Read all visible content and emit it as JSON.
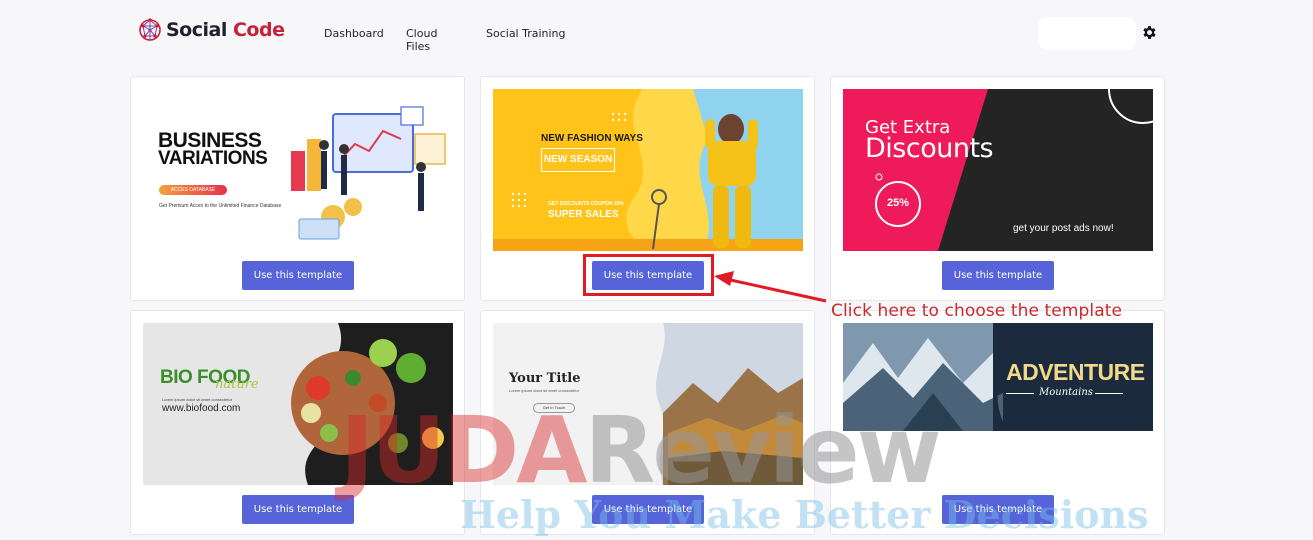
{
  "app": {
    "logo_part1": "Social",
    "logo_part2": "Code",
    "logo_icon": "network-globe-icon"
  },
  "nav": {
    "items": [
      "Dashboard",
      "Cloud Files",
      "Social Training"
    ]
  },
  "settings_icon": "gear-icon",
  "templates": [
    {
      "button_label": "Use this template",
      "preview": {
        "headline1": "BUSINESS",
        "headline2": "VARIATIONS",
        "pill": "ACCES DATABASE",
        "caption": "Get Premium Acces to the Unlimited Finance Database"
      }
    },
    {
      "button_label": "Use this template",
      "preview": {
        "headline": "NEW FASHION WAYS",
        "badge": "NEW SEASON",
        "line": "GET DISCOUNTS COUPON 20%",
        "sale": "SUPER SALES"
      }
    },
    {
      "button_label": "Use this template",
      "preview": {
        "headline1": "Get Extra",
        "headline2": "Discounts",
        "percent": "25%",
        "cta": "get your post ads now!"
      }
    },
    {
      "button_label": "Use this template",
      "preview": {
        "headline1": "BIO FOOD",
        "script": "nature",
        "caption": "Lorem ipsum dolor sit amet consectetur",
        "url": "www.biofood.com"
      }
    },
    {
      "button_label": "Use this template",
      "preview": {
        "headline": "Your Title",
        "caption": "Lorem ipsum dolor sit amet consectetur",
        "cta": "Get In Touch"
      }
    },
    {
      "button_label": "Use this template",
      "preview": {
        "headline": "ADVENTURE",
        "script": "Mountains"
      }
    }
  ],
  "annotation": {
    "text": "Click here to choose the template"
  },
  "watermark": {
    "main_red": "JUDA",
    "main_gray": "Review",
    "tagline": "Help You Make Better Decisions"
  },
  "colors": {
    "button": "#5764d9",
    "annotation": "#e01b24",
    "brand_red": "#c8213c"
  }
}
